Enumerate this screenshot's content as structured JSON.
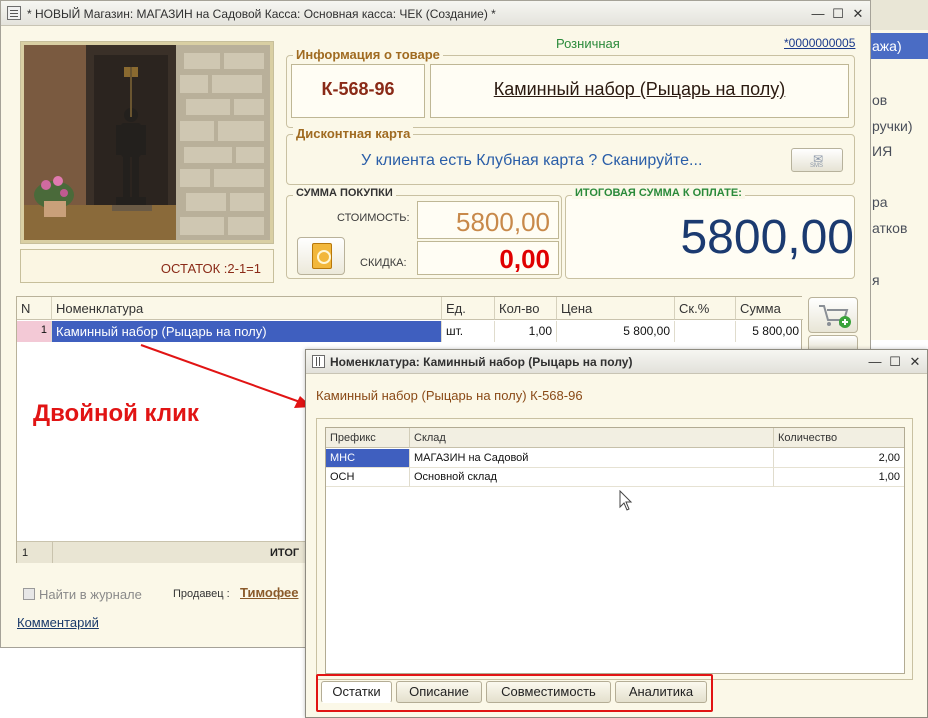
{
  "background_app": {
    "items": [
      "ажа)",
      "ов",
      "ручки)",
      "ИЯ",
      "ра",
      "атков",
      "я"
    ]
  },
  "main_window": {
    "title": "* НОВЫЙ Магазин: МАГАЗИН на Садовой Касса: Основная касса: ЧЕК (Создание) *",
    "price_type": "Розничная",
    "doc_number": "*0000000005",
    "ostatok": "ОСТАТОК :2-1=1",
    "product_info": {
      "title": "Информация о товаре",
      "code": "К-568-96",
      "name": "Каминный набор (Рыцарь на полу)"
    },
    "discount": {
      "title": "Дисконтная карта",
      "prompt": "У клиента есть Клубная карта ? Сканируйте...",
      "sms_label": "SMS"
    },
    "purchase": {
      "title": "СУММА ПОКУПКИ",
      "cost_label": "СТОИМОСТЬ:",
      "cost_value": "5800,00",
      "discount_label": "СКИДКА:",
      "discount_value": "0,00"
    },
    "total": {
      "title": "ИТОГОВАЯ СУММА К ОПЛАТЕ:",
      "value": "5800,00"
    },
    "table": {
      "columns": [
        "N",
        "Номенклатура",
        "Ед.",
        "Кол-во",
        "Цена",
        "Ск.%",
        "Сумма"
      ],
      "rows": [
        {
          "n": "1",
          "name": "Каминный набор (Рыцарь на полу)",
          "unit": "шт.",
          "qty": "1,00",
          "price": "5 800,00",
          "disc": "",
          "sum": "5 800,00"
        }
      ],
      "footer_count": "1",
      "footer_label": "ИТОГ"
    },
    "find_in_journal": "Найти в журнале",
    "seller_label": "Продавец :",
    "seller_name": "Тимофее",
    "comment": "Комментарий"
  },
  "annotation": {
    "text": "Двойной клик",
    "color": "#e11414"
  },
  "popup": {
    "title": "Номенклатура: Каминный набор (Рыцарь на полу)",
    "subtitle": "Каминный набор (Рыцарь на полу) К-568-96",
    "columns": [
      "Префикс",
      "Склад",
      "Количество"
    ],
    "rows": [
      {
        "prefix": "МНС",
        "warehouse": "МАГАЗИН на Садовой",
        "qty": "2,00"
      },
      {
        "prefix": "ОСН",
        "warehouse": "Основной склад",
        "qty": "1,00"
      }
    ],
    "tabs": [
      "Остатки",
      "Описание",
      "Совместимость",
      "Аналитика"
    ],
    "active_tab": "Остатки"
  },
  "colors": {
    "selection": "#3f5fbf",
    "window_bg": "#fbf8e8",
    "cost": "#c8894a",
    "discount": "#e00000",
    "total": "#1b3a70"
  }
}
